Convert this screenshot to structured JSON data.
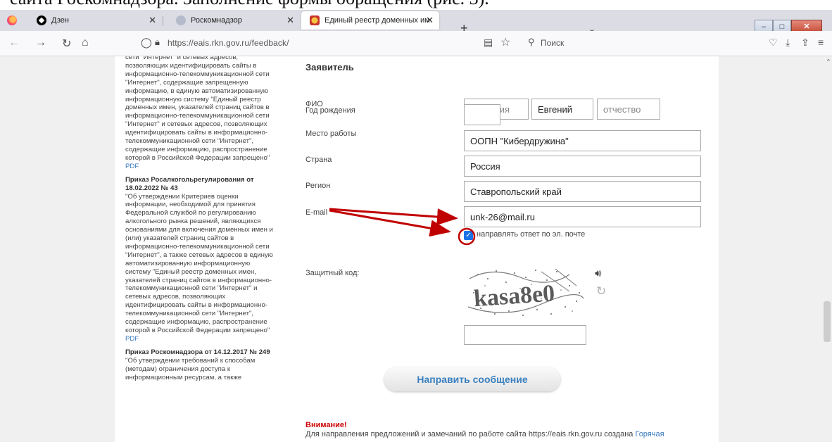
{
  "caption_fragment": "сайта Роскомнадзора. Заполнение формы обращения (рис. 3).",
  "browser": {
    "tabs": [
      {
        "label": "Дзен",
        "active": false,
        "favicon": "dzen-icon"
      },
      {
        "label": "Роскомнадзор",
        "active": false,
        "favicon": "rkn-icon"
      },
      {
        "label": "Единый реестр доменных име",
        "active": true,
        "favicon": "eagle-icon"
      }
    ],
    "new_tab": "+",
    "url": "https://eais.rkn.gov.ru/feedback/",
    "search_placeholder": "Поиск",
    "icons": {
      "back": "back-arrow-icon",
      "forward": "forward-arrow-icon",
      "reload": "reload-icon",
      "home": "home-icon",
      "pocket": "pocket-icon",
      "downloads": "download-icon",
      "share": "share-icon",
      "menu": "hamburger-menu-icon"
    }
  },
  "sidebar": {
    "docs": [
      {
        "title": "",
        "body": "сети \"Интернет\" и сетевых адресов, позволяющих идентифицировать сайты в информационно-телекоммуникационной сети \"Интернет\", содержащие запрещенную информацию, в единую автоматизированную информационную систему \"Единый реестр доменных имен, указателей страниц сайтов в информационно-телекоммуникационной сети \"Интернет\" и сетевых адресов, позволяющих идентифицировать сайты в информационно-телекоммуникационной сети \"Интернет\", содержащие информацию, распространение которой в Российской Федерации запрещено\"",
        "pdf": "PDF"
      },
      {
        "title": "Приказ Росалкогольрегулирования от 18.02.2022 № 43",
        "body": "\"Об утверждении Критериев оценки информации, необходимой для принятия Федеральной службой по регулированию алкогольного рынка решений, являющихся основаниями для включения доменных имен и (или) указателей страниц сайтов в информационно-телекоммуникационной сети \"Интернет\", а также сетевых адресов в единую автоматизированную информационную систему \"Единый реестр доменных имен, указателей страниц сайтов в информационно-телекоммуникационной сети \"Интернет\" и сетевых адресов, позволяющих идентифицировать сайты в информационно-телекоммуникационной сети \"Интернет\", содержащие информацию, распространение которой в Российской Федерации запрещено\"",
        "pdf": "PDF"
      },
      {
        "title": "Приказ Роскомнадзора от 14.12.2017 № 249",
        "body": "\"Об утверждении требований к способам (методам) ограничения доступа к информационным ресурсам, а также",
        "pdf": ""
      }
    ]
  },
  "form": {
    "section_title": "Заявитель",
    "fio_label": "ФИО",
    "fio": {
      "surname_placeholder": "фамилия",
      "name_value": "Евгений",
      "patronymic_placeholder": "отчество"
    },
    "birth_year_label": "Год рождения",
    "birth_year_value": "",
    "workplace_label": "Место работы",
    "workplace_value": "ООПН \"Кибердружина\"",
    "country_label": "Страна",
    "country_value": "Россия",
    "region_label": "Регион",
    "region_value": "Ставропольский край",
    "email_label": "E-mail",
    "email_value": "unk-26@mail.ru",
    "reply_checkbox_label": "направлять ответ по эл. почте",
    "reply_checkbox_checked": true,
    "captcha_label": "Защитный код:",
    "captcha_text": "kasa8e0",
    "captcha_value": "",
    "submit_label": "Направить сообщение",
    "warning_title": "Внимание!",
    "notice_text": "Для направления предложений и замечаний по работе сайта https://eais.rkn.gov.ru создана",
    "notice_link": "Горячая"
  },
  "colors": {
    "accent_blue": "#3a80c0",
    "annotation_red": "#c00000",
    "warning_red": "#cc0000",
    "checkbox_blue": "#1a73e8"
  }
}
